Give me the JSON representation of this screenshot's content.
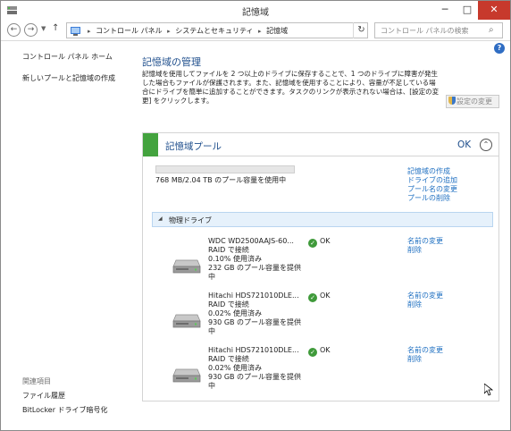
{
  "window": {
    "title": "記憶域",
    "controls": {
      "minimize": "─",
      "maximize": "□",
      "close": "✕"
    }
  },
  "address": {
    "crumbs": [
      "コントロール パネル",
      "システムとセキュリティ",
      "記憶域"
    ],
    "search_placeholder": "コントロール パネルの検索"
  },
  "sidebar": {
    "home": "コントロール パネル ホーム",
    "create_pool": "新しいプールと記憶域の作成",
    "related_heading": "関連項目",
    "related": [
      "ファイル履歴",
      "BitLocker ドライブ暗号化"
    ]
  },
  "main": {
    "title": "記憶域の管理",
    "description": "記憶域を使用してファイルを 2 つ以上のドライブに保存することで、1 つのドライブに障害が発生した場合もファイルが保護されます。また、記憶域を使用することにより、容量が不足している場合にドライブを簡単に追加することができます。タスクのリンクが表示されない場合は、[設定の変更] をクリックします。",
    "change_settings": "設定の変更"
  },
  "pool": {
    "title": "記憶域プール",
    "status": "OK",
    "usage_text": "768 MB/2.04 TB のプール容量を使用中",
    "usage_fraction": 0.0004,
    "actions": [
      "記憶域の作成",
      "ドライブの追加",
      "プール名の変更",
      "プールの削除"
    ],
    "physical_heading": "物理ドライブ",
    "drives": [
      {
        "name": "WDC WD2500AAJS-60...",
        "connection": "RAID で接続",
        "used": "0.10% 使用済み",
        "capacity": "232 GB のプール容量を提供中",
        "status": "OK",
        "actions": [
          "名前の変更",
          "削除"
        ]
      },
      {
        "name": "Hitachi HDS721010DLE...",
        "connection": "RAID で接続",
        "used": "0.02% 使用済み",
        "capacity": "930 GB のプール容量を提供中",
        "status": "OK",
        "actions": [
          "名前の変更",
          "削除"
        ]
      },
      {
        "name": "Hitachi HDS721010DLE...",
        "connection": "RAID で接続",
        "used": "0.02% 使用済み",
        "capacity": "930 GB のプール容量を提供中",
        "status": "OK",
        "actions": [
          "名前の変更",
          "削除"
        ]
      }
    ]
  },
  "colors": {
    "link": "#1e6fc1",
    "heading": "#1e4e8c",
    "pool_stripe": "#43a33e",
    "close_button": "#c7392c",
    "ok_icon": "#3f9a3a"
  },
  "icons": [
    "storage-spaces-icon",
    "back-icon",
    "forward-icon",
    "up-icon",
    "refresh-icon",
    "search-icon",
    "help-icon",
    "shield-icon",
    "collapse-icon",
    "hard-drive-icon",
    "ok-check-icon"
  ]
}
